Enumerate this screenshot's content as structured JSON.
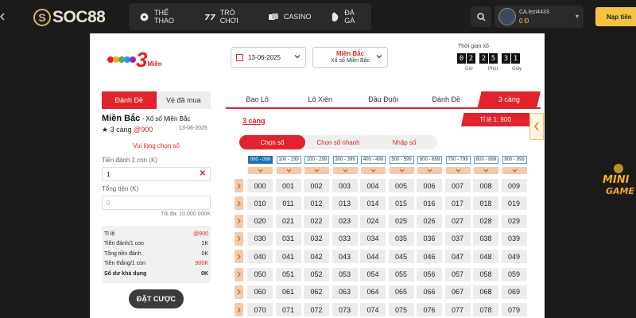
{
  "header": {
    "brand": "SOC88",
    "nav": [
      {
        "label": "THỂ THAO",
        "icon": "soccer-ball-icon"
      },
      {
        "label": "TRÒ CHƠI",
        "icon": "slot-machine-icon"
      },
      {
        "label": "CASINO",
        "icon": "cards-icon"
      },
      {
        "label": "ĐÁ GÀ",
        "icon": "rooster-icon"
      }
    ],
    "user": {
      "name": "CA.lezi4433",
      "balance": "0 Đ"
    },
    "deposit_label": "Nạp tiền"
  },
  "lottery": {
    "logo_number": "3",
    "logo_text": "Miền",
    "date": "13-06-2025",
    "region_title": "Miền Bắc",
    "region_sub": "Xổ số Miền Bắc",
    "timer_label": "Thời gian xổ",
    "timer": {
      "hours": [
        "0",
        "2"
      ],
      "minutes": [
        "2",
        "5"
      ],
      "seconds": [
        "3",
        "1"
      ]
    },
    "timer_units": [
      "Giờ",
      "Phút",
      "Giây"
    ]
  },
  "left": {
    "tabs": [
      "Đánh Đề",
      "Vé đã mua"
    ],
    "region_name": "Miền Bắc",
    "region_suffix": " - Xổ số Miền Bắc",
    "bet_type": "★ 3 càng ",
    "bet_rate": "@900",
    "bet_date": "13-06-2025",
    "choose_msg": "Vui lòng chọn số",
    "amount_label": "Tiền đánh 1 con (K)",
    "amount_value": "1",
    "total_label": "Tổng tiền (K)",
    "total_placeholder": "0",
    "max_note": "Tối đa: 10.000.000K",
    "summary": [
      {
        "label": "Tỉ lệ",
        "value": "@900",
        "red": true
      },
      {
        "label": "Tiền đánh/1 con",
        "value": "1K",
        "red": false
      },
      {
        "label": "Tổng tiền đánh",
        "value": "0K",
        "red": false
      },
      {
        "label": "Tiền thắng/1 con",
        "value": "900K",
        "red": true
      },
      {
        "label": "Số dư khả dụng",
        "value": "0K",
        "red": false,
        "bold": true
      }
    ],
    "place_bet": "ĐẶT CƯỢC"
  },
  "right": {
    "tabs": [
      "Bao Lô",
      "Lô Xiên",
      "Đầu Đuôi",
      "Đánh Đề",
      "3 càng"
    ],
    "active_tab": 4,
    "section_title": "3 càng",
    "ratio": "Tỉ lệ 1: 900",
    "pick_tabs": [
      "Chọn số",
      "Chọn số nhanh",
      "Nhập số"
    ],
    "groups": [
      "000 - 099",
      "100 - 199",
      "200 - 299",
      "300 - 399",
      "400 - 499",
      "500 - 599",
      "600 - 699",
      "700 - 799",
      "800 - 899",
      "900 - 999"
    ],
    "rows": [
      [
        "000",
        "001",
        "002",
        "003",
        "004",
        "005",
        "006",
        "007",
        "008",
        "009"
      ],
      [
        "010",
        "011",
        "012",
        "013",
        "014",
        "015",
        "016",
        "017",
        "018",
        "019"
      ],
      [
        "020",
        "021",
        "022",
        "023",
        "024",
        "025",
        "026",
        "027",
        "028",
        "029"
      ],
      [
        "030",
        "031",
        "032",
        "033",
        "034",
        "035",
        "036",
        "037",
        "038",
        "039"
      ],
      [
        "040",
        "041",
        "042",
        "043",
        "044",
        "045",
        "046",
        "047",
        "048",
        "049"
      ],
      [
        "050",
        "051",
        "052",
        "053",
        "054",
        "055",
        "056",
        "057",
        "058",
        "059"
      ],
      [
        "060",
        "061",
        "062",
        "063",
        "064",
        "065",
        "066",
        "067",
        "068",
        "069"
      ],
      [
        "070",
        "071",
        "072",
        "073",
        "074",
        "075",
        "076",
        "077",
        "078",
        "079"
      ]
    ]
  },
  "colors": {
    "accent": "#e0232d",
    "gold": "#f5c542",
    "header_bg": "#1b1b1b"
  }
}
